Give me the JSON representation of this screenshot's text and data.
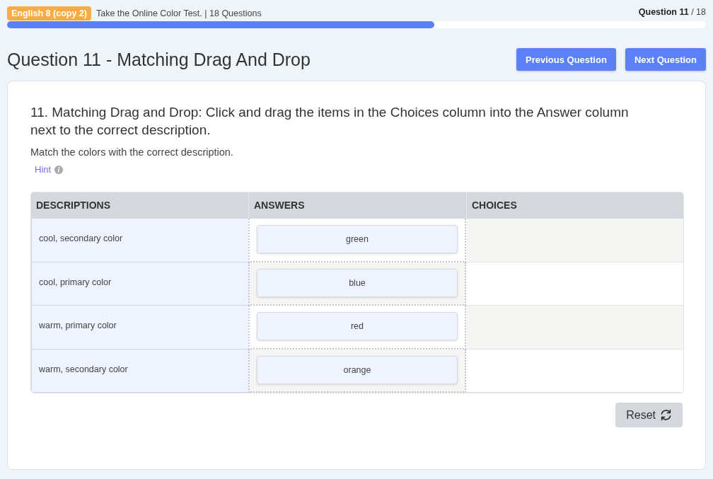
{
  "header": {
    "course_badge": "English 8 (copy 2)",
    "test_info": "Take the Online Color Test. | 18 Questions",
    "question_counter": "**Question 11** / 18",
    "progress": {
      "level": 0.611
    }
  },
  "title": "Question 11 - Matching Drag And Drop",
  "nav_buttons": [
    "Previous Question",
    "Next Question"
  ],
  "question": {
    "prompt": "11. Matching Drag and Drop: Click and drag the items in the Choices column into the Answer column next to the correct description.",
    "instruction": "Match the colors with the correct description.",
    "hint": "Hint"
  },
  "table": {
    "columns": [
      "DESCRIPTIONS",
      "ANSWERS",
      "CHOICES"
    ],
    "rows": [
      {
        "description": "cool, secondary color",
        "answer": "green"
      },
      {
        "description": "cool, primary color",
        "answer": "blue"
      },
      {
        "description": "warm, primary color",
        "answer": "red"
      },
      {
        "description": "warm, secondary color",
        "answer": "orange"
      }
    ]
  },
  "reset_button": "Reset"
}
